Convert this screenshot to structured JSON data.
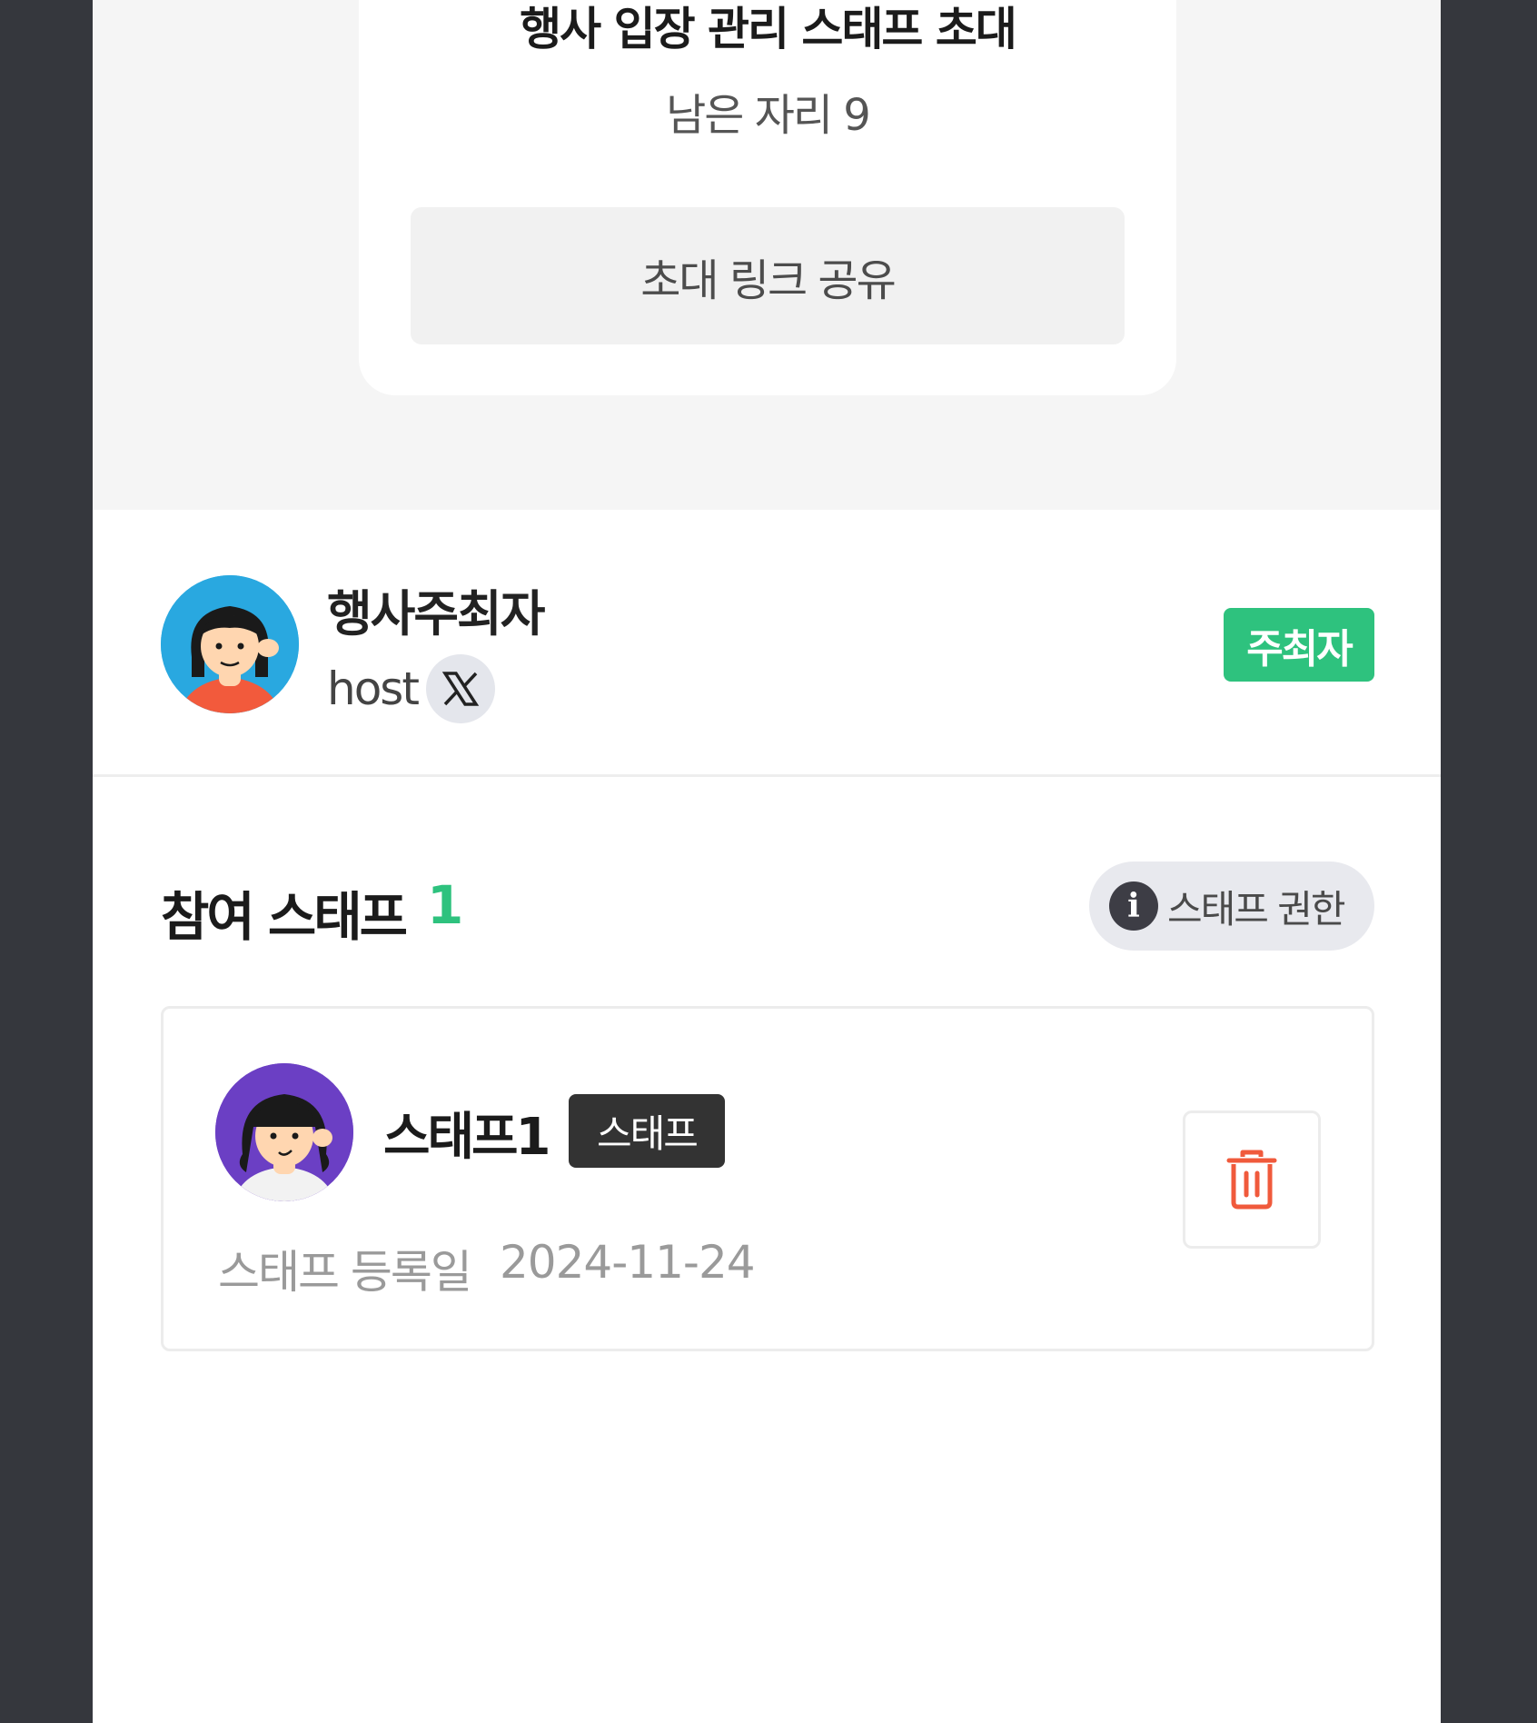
{
  "invite": {
    "title": "행사 입장 관리 스태프 초대",
    "remaining": "남은 자리 9",
    "share_label": "초대 링크 공유"
  },
  "host": {
    "name": "행사주최자",
    "id": "host",
    "social_icon": "x-logo-icon",
    "badge": "주최자"
  },
  "staff": {
    "title": "참여 스태프",
    "count": "1",
    "permission_label": "스태프 권한",
    "members": [
      {
        "name": "스태프1",
        "role": "스태프",
        "registered_label": "스태프 등록일",
        "registered_date": "2024-11-24"
      }
    ]
  },
  "colors": {
    "accent_green": "#2ec27e",
    "delete_red": "#f05a3c",
    "background_dark": "#35373d"
  }
}
